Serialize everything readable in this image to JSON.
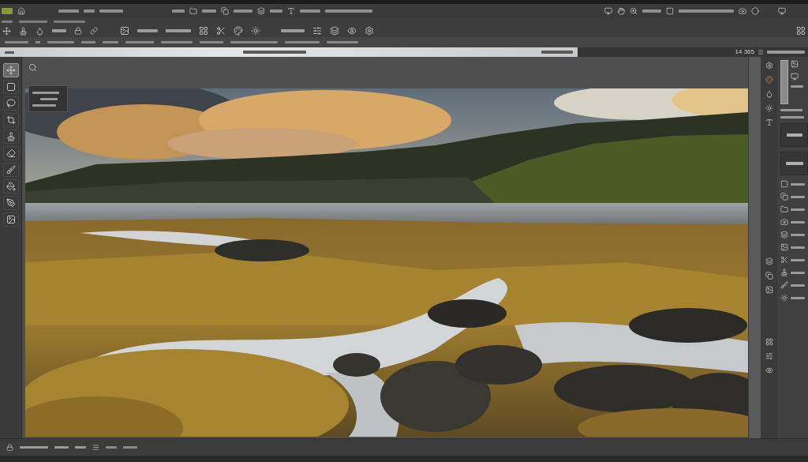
{
  "document_tab": {
    "selected": true
  },
  "tab_bar_info": "14 365",
  "tools": [
    {
      "kind": "move",
      "selected": true
    },
    {
      "kind": "marquee",
      "selected": false
    },
    {
      "kind": "lasso",
      "selected": false
    },
    {
      "kind": "crop",
      "selected": false
    },
    {
      "kind": "stamp",
      "selected": false
    },
    {
      "kind": "eraser",
      "selected": false
    },
    {
      "kind": "brush",
      "selected": false
    },
    {
      "kind": "bucket",
      "selected": false
    },
    {
      "kind": "pen",
      "selected": false
    },
    {
      "kind": "image",
      "selected": false
    }
  ]
}
